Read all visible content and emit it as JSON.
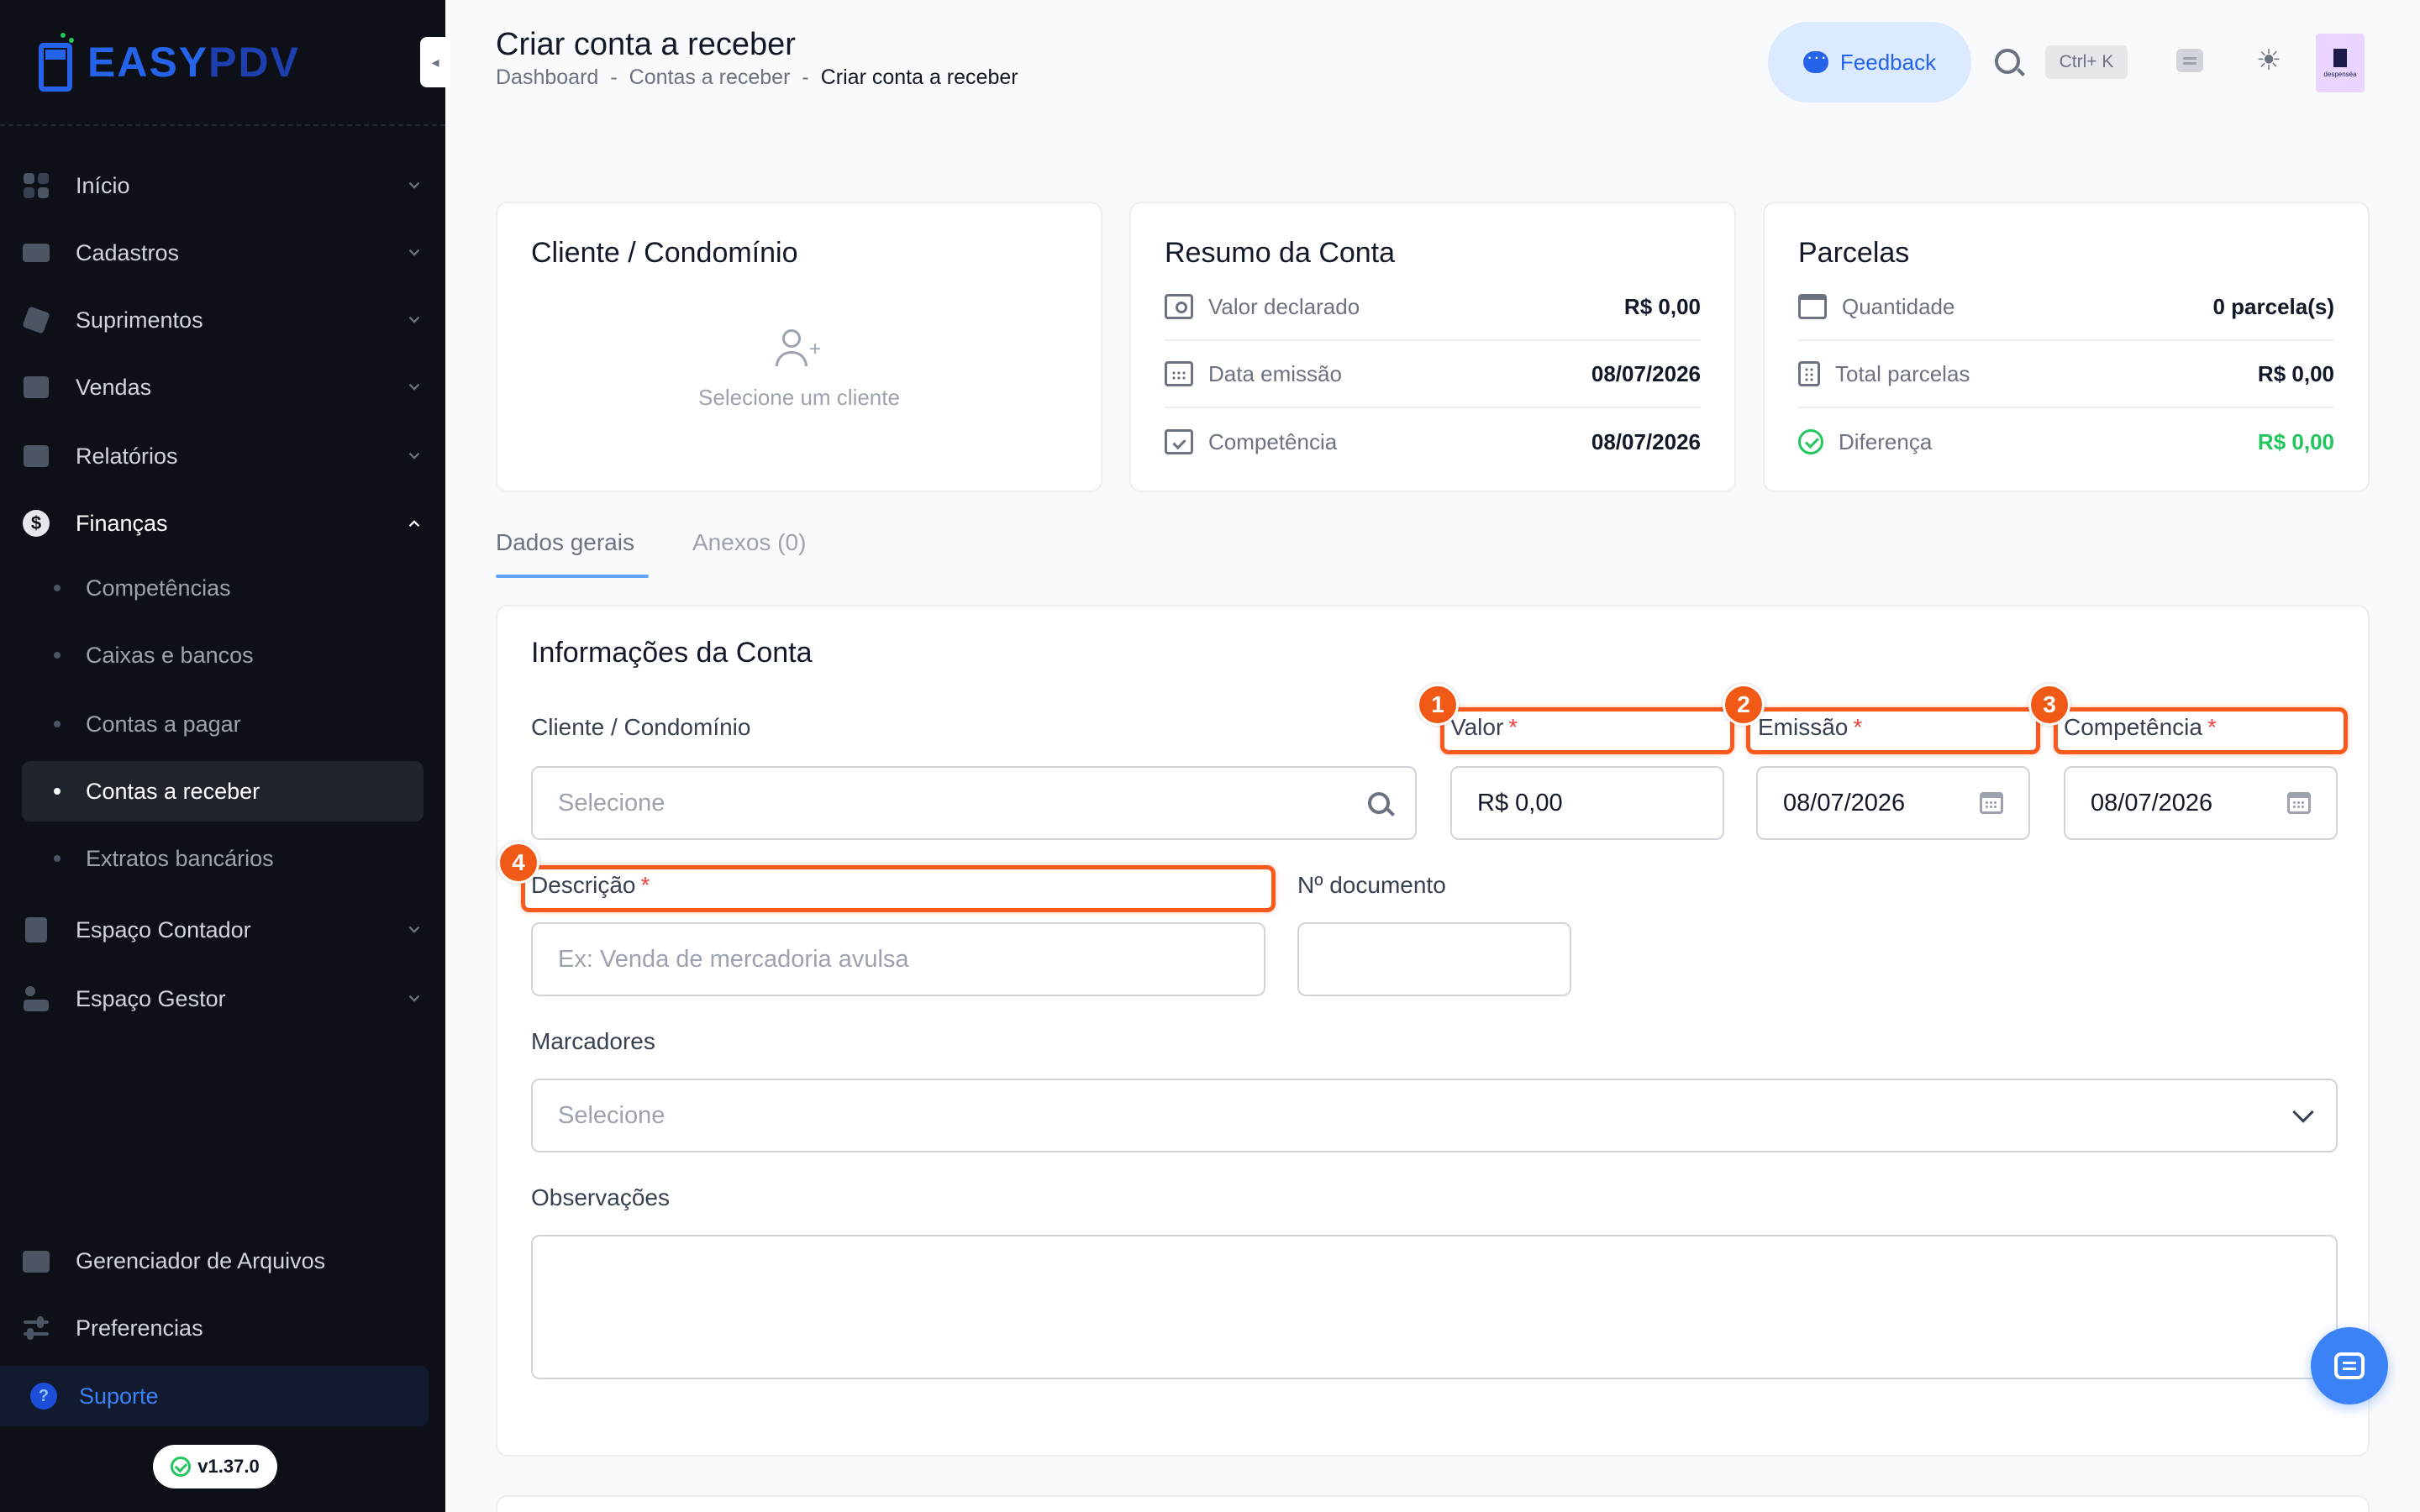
{
  "brand": {
    "name_part1": "EASY",
    "name_part2": "PDV"
  },
  "sidebar": {
    "items": [
      {
        "label": "Início"
      },
      {
        "label": "Cadastros"
      },
      {
        "label": "Suprimentos"
      },
      {
        "label": "Vendas"
      },
      {
        "label": "Relatórios"
      },
      {
        "label": "Finanças"
      },
      {
        "label": "Espaço Contador"
      },
      {
        "label": "Espaço Gestor"
      }
    ],
    "finance_sub": [
      {
        "label": "Competências"
      },
      {
        "label": "Caixas e bancos"
      },
      {
        "label": "Contas a pagar"
      },
      {
        "label": "Contas a receber"
      },
      {
        "label": "Extratos bancários"
      }
    ],
    "bottom": [
      {
        "label": "Gerenciador de Arquivos"
      },
      {
        "label": "Preferencias"
      }
    ],
    "support_label": "Suporte",
    "version": "v1.37.0"
  },
  "header": {
    "title": "Criar conta a receber",
    "breadcrumb": [
      "Dashboard",
      "-",
      "Contas a receber",
      "-",
      "Criar conta a receber"
    ],
    "feedback_label": "Feedback",
    "shortcut": "Ctrl+ K",
    "avatar_text": "despenséa"
  },
  "client_card": {
    "title": "Cliente / Condomínio",
    "empty_text": "Selecione um cliente"
  },
  "summary_card": {
    "title": "Resumo da Conta",
    "rows": [
      {
        "label": "Valor declarado",
        "value": "R$ 0,00"
      },
      {
        "label": "Data emissão",
        "value": "08/07/2026"
      },
      {
        "label": "Competência",
        "value": "08/07/2026"
      }
    ]
  },
  "installments_card": {
    "title": "Parcelas",
    "rows": [
      {
        "label": "Quantidade",
        "value": "0 parcela(s)"
      },
      {
        "label": "Total parcelas",
        "value": "R$ 0,00"
      },
      {
        "label": "Diferença",
        "value": "R$ 0,00"
      }
    ]
  },
  "tabs": [
    {
      "label": "Dados gerais"
    },
    {
      "label": "Anexos (0)"
    }
  ],
  "form": {
    "section_title": "Informações da Conta",
    "client_label": "Cliente / Condomínio",
    "client_placeholder": "Selecione",
    "value_label": "Valor",
    "value": "R$ 0,00",
    "issue_label": "Emissão",
    "issue_value": "08/07/2026",
    "competence_label": "Competência",
    "competence_value": "08/07/2026",
    "description_label": "Descrição",
    "description_placeholder": "Ex: Venda de mercadoria avulsa",
    "doc_label": "Nº documento",
    "doc_value": "",
    "tags_label": "Marcadores",
    "tags_placeholder": "Selecione",
    "notes_label": "Observações",
    "required_mark": "*"
  },
  "annotations": [
    "1",
    "2",
    "3",
    "4"
  ],
  "colors": {
    "accent": "#2563eb",
    "highlight": "#f9591c",
    "success": "#22c55e",
    "required": "#ef4444",
    "sidebar_bg": "#0d1117"
  }
}
